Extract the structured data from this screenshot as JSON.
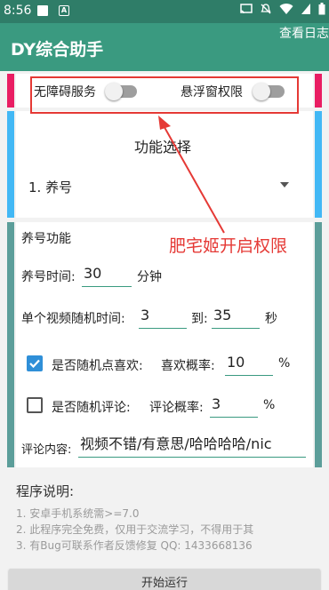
{
  "statusbar": {
    "time": "8:56"
  },
  "app": {
    "title": "DY综合助手",
    "action_label": "查看日志"
  },
  "permissions": {
    "accessibility_label": "无障碍服务",
    "overlay_label": "悬浮窗权限"
  },
  "function_select": {
    "title": "功能选择",
    "selected": "1. 养号"
  },
  "raise": {
    "title": "养号功能",
    "time_label": "养号时间:",
    "time_value": "30",
    "time_unit": "分钟",
    "video_time_label": "单个视频随机时间:",
    "video_time_min": "3",
    "to_label": "到:",
    "video_time_max": "35",
    "seconds_unit": "秒",
    "like_checkbox_label": "是否随机点喜欢:",
    "like_checked": true,
    "like_rate_label": "喜欢概率:",
    "like_rate_value": "10",
    "like_rate_unit": "%",
    "comment_checkbox_label": "是否随机评论:",
    "comment_checked": false,
    "comment_rate_label": "评论概率:",
    "comment_rate_value": "3",
    "comment_rate_unit": "%",
    "comment_content_label": "评论内容:",
    "comment_content_value": "视频不错/有意思/哈哈哈哈/nic"
  },
  "notes": {
    "title": "程序说明:",
    "lines": [
      "1. 安卓手机系统需>=7.0",
      "2. 此程序完全免费，仅用于交流学习，不得用于其",
      "3. 有Bug可联系作者反馈修复 QQ: 1433668136"
    ]
  },
  "start_button": "开始运行",
  "annotation": {
    "text": "肥宅姬开启权限",
    "color": "#e53935"
  },
  "colors": {
    "primary": "#3a9a80",
    "primary_dark": "#2f7d68",
    "accent_pink": "#e91e63",
    "accent_blue": "#42b8f5",
    "accent_teal": "#5c9e9a",
    "checkbox": "#2f8fd8"
  }
}
